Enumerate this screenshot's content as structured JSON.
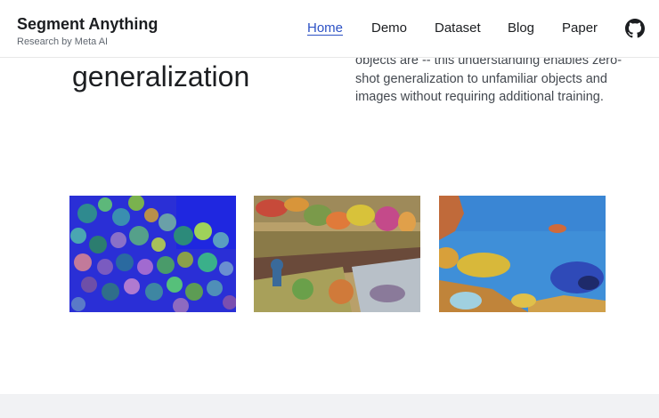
{
  "header": {
    "title": "Segment Anything",
    "subtitle": "Research by Meta AI",
    "nav": [
      {
        "label": "Home",
        "active": true
      },
      {
        "label": "Demo",
        "active": false
      },
      {
        "label": "Dataset",
        "active": false
      },
      {
        "label": "Blog",
        "active": false
      },
      {
        "label": "Paper",
        "active": false
      }
    ],
    "github_icon": "github-icon"
  },
  "hero": {
    "heading_fragment": "generalization",
    "description_lines": [
      "objects are -- this understanding enables zero-",
      "shot generalization to unfamiliar objects and",
      "images without requiring additional training."
    ]
  },
  "gallery": {
    "images": [
      {
        "subject": "coral-reef-segmentation"
      },
      {
        "subject": "painting-segmentation"
      },
      {
        "subject": "underwater-fish-segmentation"
      }
    ]
  },
  "colors": {
    "accent": "#2d52c5",
    "text": "#1c1e21",
    "muted": "#606770",
    "footer_band": "#f1f2f4"
  }
}
